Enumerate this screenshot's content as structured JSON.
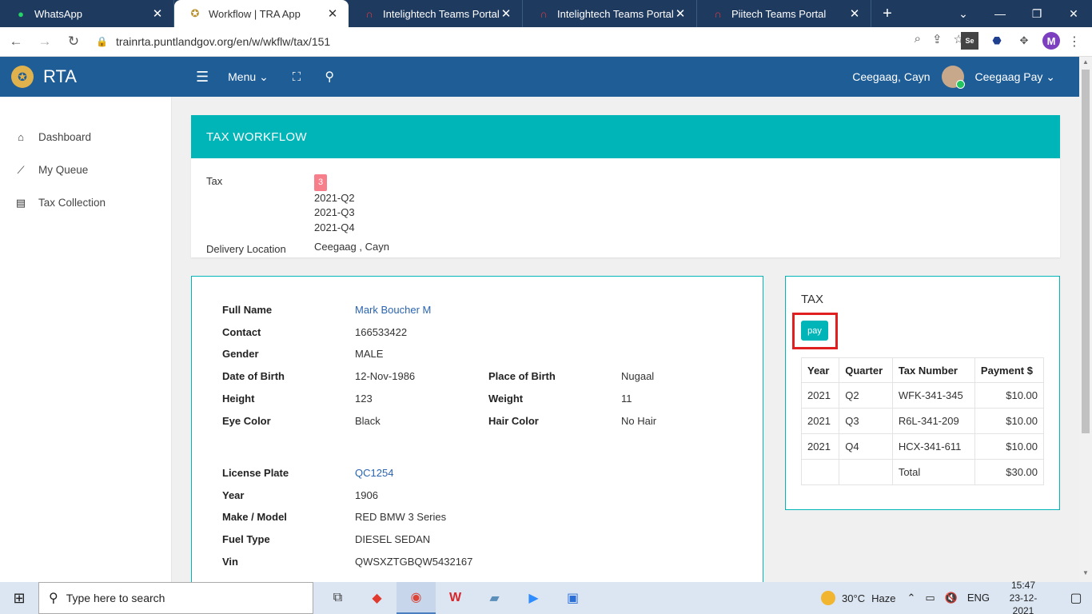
{
  "browser": {
    "tabs": [
      {
        "title": "WhatsApp",
        "icon": "whatsapp-icon",
        "active": false
      },
      {
        "title": "Workflow | TRA App",
        "icon": "emblem-icon",
        "active": true
      },
      {
        "title": "Intelightech Teams Portal",
        "icon": "headset-icon",
        "active": false
      },
      {
        "title": "Intelightech Teams Portal",
        "icon": "headset-icon",
        "active": false
      },
      {
        "title": "Piitech Teams Portal",
        "icon": "headset-icon",
        "active": false
      }
    ],
    "url": "trainrta.puntlandgov.org/en/w/wkflw/tax/151",
    "profile_initial": "M",
    "ext_se": "Se"
  },
  "app": {
    "brand": "RTA",
    "menu_label": "Menu",
    "user_location": "Ceegaag, Cayn",
    "user_name": "Ceegaag Pay"
  },
  "sidebar": {
    "items": [
      {
        "label": "Dashboard",
        "icon": "home-icon"
      },
      {
        "label": "My Queue",
        "icon": "trend-icon"
      },
      {
        "label": "Tax Collection",
        "icon": "list-icon"
      }
    ]
  },
  "workflow": {
    "title": "TAX WORKFLOW",
    "tax_label": "Tax",
    "tax_count": "3",
    "quarters": [
      "2021-Q2",
      "2021-Q3",
      "2021-Q4"
    ],
    "delivery_label": "Delivery Location",
    "delivery_value": "Ceegaag , Cayn"
  },
  "person": {
    "full_name_label": "Full Name",
    "full_name": "Mark Boucher M",
    "contact_label": "Contact",
    "contact": "166533422",
    "gender_label": "Gender",
    "gender": "MALE",
    "dob_label": "Date of Birth",
    "dob": "12-Nov-1986",
    "pob_label": "Place of Birth",
    "pob": "Nugaal",
    "height_label": "Height",
    "height": "123",
    "weight_label": "Weight",
    "weight": "11",
    "eye_label": "Eye Color",
    "eye": "Black",
    "hair_label": "Hair Color",
    "hair": "No Hair"
  },
  "vehicle": {
    "plate_label": "License Plate",
    "plate": "QC1254",
    "year_label": "Year",
    "year": "1906",
    "make_label": "Make / Model",
    "make": "RED BMW 3 Series",
    "fuel_label": "Fuel Type",
    "fuel": "DIESEL SEDAN",
    "vin_label": "Vin",
    "vin": "QWSXZTGBQW5432167"
  },
  "tax_panel": {
    "title": "TAX",
    "pay_label": "pay",
    "headers": [
      "Year",
      "Quarter",
      "Tax Number",
      "Payment $"
    ],
    "rows": [
      [
        "2021",
        "Q2",
        "WFK-341-345",
        "$10.00"
      ],
      [
        "2021",
        "Q3",
        "R6L-341-209",
        "$10.00"
      ],
      [
        "2021",
        "Q4",
        "HCX-341-611",
        "$10.00"
      ]
    ],
    "total_label": "Total",
    "total_value": "$30.00"
  },
  "taskbar": {
    "search_placeholder": "Type here to search",
    "weather_temp": "30°C",
    "weather_text": "Haze",
    "lang": "ENG",
    "time": "15:47",
    "date": "23-12-2021"
  },
  "colors": {
    "header_blue": "#1f5d96",
    "teal": "#00b5b8",
    "highlight_red": "#e02020",
    "badge_pink": "#f77e8b"
  }
}
